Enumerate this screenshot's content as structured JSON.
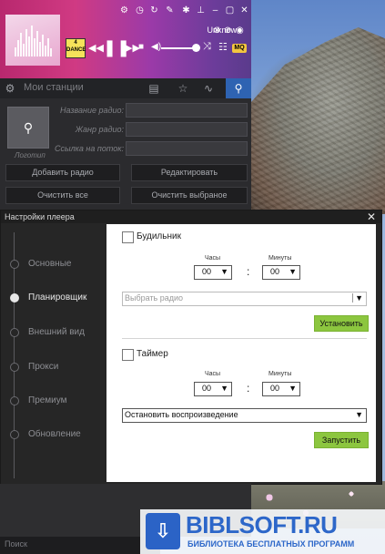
{
  "player": {
    "track_title": "Unknow",
    "cover_badge": "4 DANCE",
    "quality_badge": "MQ",
    "nav": {
      "my_stations_label": "Мои станции"
    },
    "form": {
      "logo_label": "Логотип",
      "radio_name_label": "Название радио:",
      "radio_genre_label": "Жанр радио:",
      "stream_link_label": "Ссылка на поток:"
    },
    "buttons": {
      "add_radio": "Добавить радио",
      "edit": "Редактировать",
      "clear_all": "Очистить все",
      "clear_selected": "Очистить выбраное"
    },
    "search_placeholder": "Поиск",
    "volume": 0.85
  },
  "settings": {
    "title": "Настройки плеера",
    "nav": [
      {
        "label": "Основные",
        "active": false
      },
      {
        "label": "Планировщик",
        "active": true
      },
      {
        "label": "Внешний вид",
        "active": false
      },
      {
        "label": "Прокси",
        "active": false
      },
      {
        "label": "Премиум",
        "active": false
      },
      {
        "label": "Обновление",
        "active": false
      }
    ],
    "alarm": {
      "label": "Будильник",
      "hours_caption": "Часы",
      "minutes_caption": "Минуты",
      "hours_value": "00",
      "minutes_value": "00",
      "separator": ":",
      "radio_select_placeholder": "Выбрать радио",
      "set_button": "Установить"
    },
    "timer": {
      "label": "Таймер",
      "hours_caption": "Часы",
      "minutes_caption": "Минуты",
      "hours_value": "00",
      "minutes_value": "00",
      "separator": ":",
      "action_value": "Остановить воспроизведение",
      "start_button": "Запустить"
    }
  },
  "watermark": {
    "title": "BIBLSOFT.RU",
    "subtitle": "БИБЛИОТЕКА БЕСПЛАТНЫХ ПРОГРАММ"
  },
  "colors": {
    "player_gradient_start": "#b8286e",
    "player_gradient_end": "#5a3b8c",
    "accent_blue": "#2e63b2",
    "accent_green": "#8cc63f",
    "watermark_blue": "#2d67c9"
  }
}
